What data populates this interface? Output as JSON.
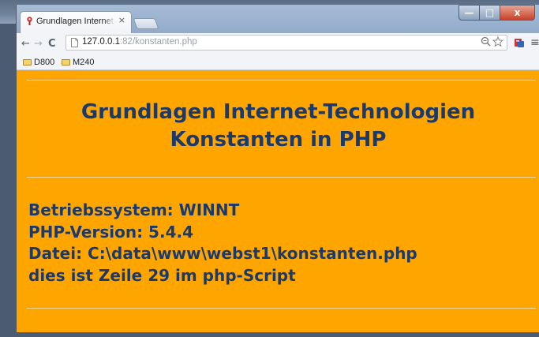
{
  "browser": {
    "tab": {
      "title": "Grundlagen Internet-",
      "close": "×"
    },
    "nav": {
      "back": "←",
      "forward": "→",
      "reload": "C"
    },
    "address": {
      "host": "127.0.0.1",
      "rest": ":82/konstanten.php"
    },
    "omnibox_icons": [
      "zoom-icon",
      "star-icon"
    ],
    "menu": "≡",
    "window_controls": {
      "minimize": "—",
      "maximize": "□",
      "close": "x"
    },
    "bookmarks": [
      {
        "label": "D800"
      },
      {
        "label": "M240"
      }
    ]
  },
  "page": {
    "background": "#ffa500",
    "text_color": "#1a3a6e",
    "heading": {
      "line1": "Grundlagen Internet-Technologien",
      "line2": "Konstanten in PHP"
    },
    "info_lines": [
      "Betriebssystem: WINNT",
      "PHP-Version: 5.4.4",
      "Datei: C:\\data\\www\\webst1\\konstanten.php",
      "dies ist Zeile 29 im php-Script"
    ]
  }
}
